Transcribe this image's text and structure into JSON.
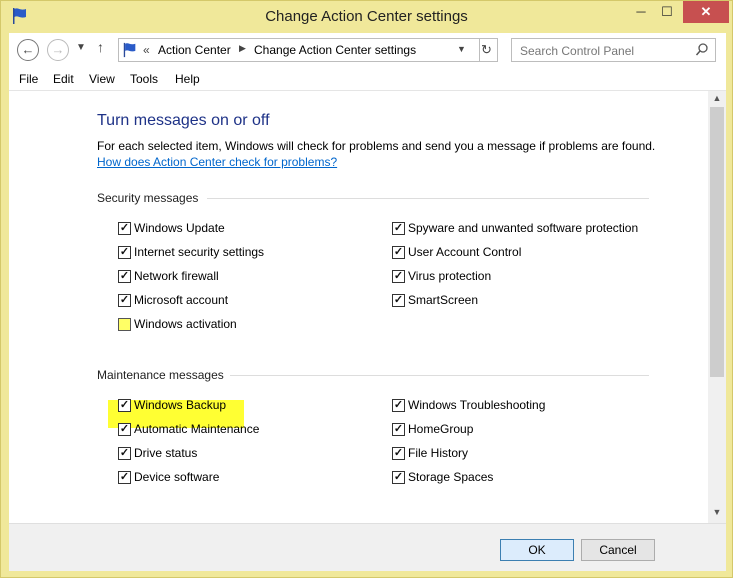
{
  "window": {
    "title": "Change Action Center settings",
    "icons": {
      "app": "flag-icon",
      "minimize": "minimize-icon",
      "maximize": "maximize-icon",
      "close": "close-icon"
    }
  },
  "navigation": {
    "back_icon": "back-arrow-icon",
    "forward_icon": "forward-arrow-icon",
    "recent_icon": "chevron-down-icon",
    "up_icon": "up-arrow-icon",
    "breadcrumb_sep": "«",
    "breadcrumb": [
      "Action Center",
      "Change Action Center settings"
    ],
    "refresh_icon": "refresh-icon",
    "search_placeholder": "Search Control Panel",
    "search_icon": "search-icon"
  },
  "menu": [
    "File",
    "Edit",
    "View",
    "Tools",
    "Help"
  ],
  "content": {
    "heading": "Turn messages on or off",
    "description": "For each selected item, Windows will check for problems and send you a message if problems are found.",
    "link": "How does Action Center check for problems?"
  },
  "security": {
    "title": "Security messages",
    "left": [
      {
        "label": "Windows Update",
        "checked": true
      },
      {
        "label": "Internet security settings",
        "checked": true
      },
      {
        "label": "Network firewall",
        "checked": true
      },
      {
        "label": "Microsoft account",
        "checked": true
      },
      {
        "label": "Windows activation",
        "checked": false,
        "highlighted": true
      }
    ],
    "right": [
      {
        "label": "Spyware and unwanted software protection",
        "checked": true
      },
      {
        "label": "User Account Control",
        "checked": true
      },
      {
        "label": "Virus protection",
        "checked": true
      },
      {
        "label": "SmartScreen",
        "checked": true
      }
    ]
  },
  "maintenance": {
    "title": "Maintenance messages",
    "left": [
      {
        "label": "Windows Backup",
        "checked": true
      },
      {
        "label": "Automatic Maintenance",
        "checked": true
      },
      {
        "label": "Drive status",
        "checked": true
      },
      {
        "label": "Device software",
        "checked": true
      }
    ],
    "right": [
      {
        "label": "Windows Troubleshooting",
        "checked": true
      },
      {
        "label": "HomeGroup",
        "checked": true
      },
      {
        "label": "File History",
        "checked": true
      },
      {
        "label": "Storage Spaces",
        "checked": true
      }
    ]
  },
  "buttons": {
    "ok": "OK",
    "cancel": "Cancel"
  },
  "colors": {
    "window_frame": "#f0e89a",
    "heading": "#1e3287",
    "link": "#0066cc",
    "highlight": "#ffff33",
    "close_button": "#c75050"
  }
}
